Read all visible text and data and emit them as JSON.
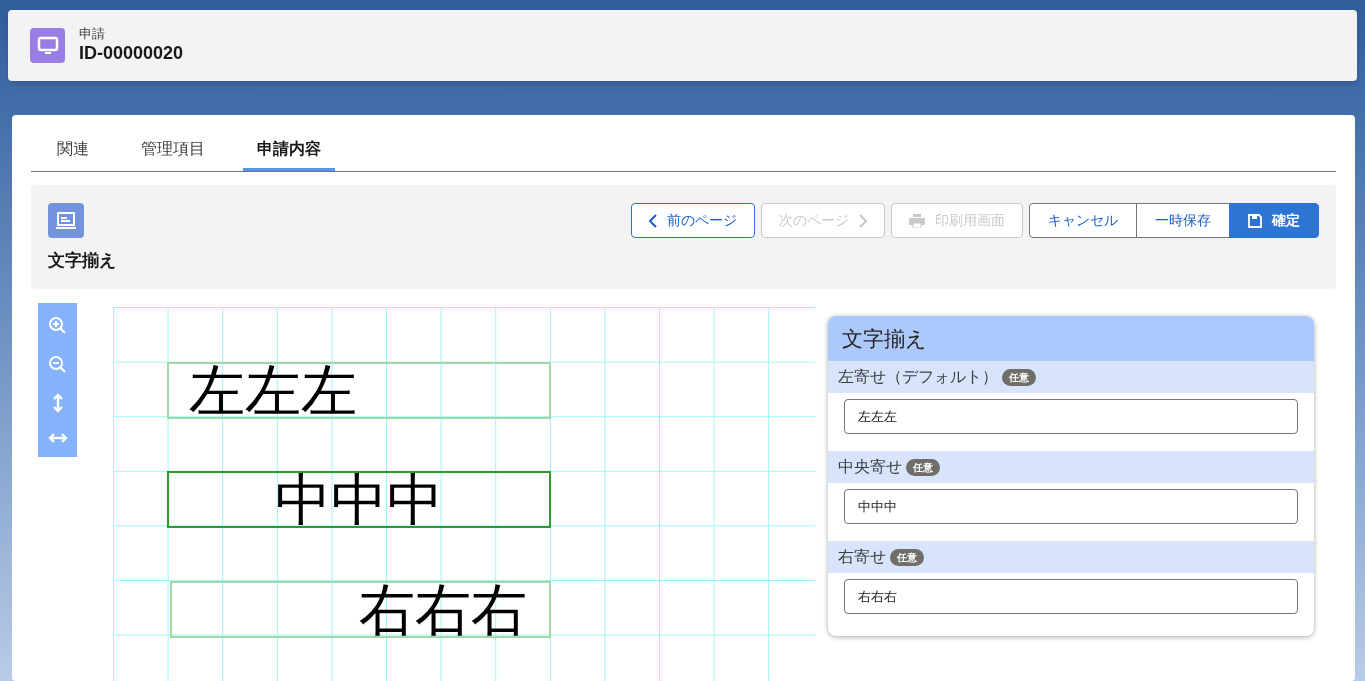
{
  "header": {
    "object_type": "申請",
    "record_id": "ID-00000020"
  },
  "tabs": [
    {
      "label": "関連",
      "selected": false
    },
    {
      "label": "管理項目",
      "selected": false
    },
    {
      "label": "申請内容",
      "selected": true
    }
  ],
  "section": {
    "title": "文字揃え"
  },
  "page_buttons": [
    {
      "label": "前のページ",
      "kind": "prev",
      "disabled": false
    },
    {
      "label": "次のページ",
      "kind": "next",
      "disabled": true
    },
    {
      "label": "印刷用画面",
      "kind": "print",
      "disabled": true
    }
  ],
  "action_buttons": [
    {
      "label": "キャンセル",
      "kind": "plain",
      "primary": false
    },
    {
      "label": "一時保存",
      "kind": "plain",
      "primary": false
    },
    {
      "label": "確定",
      "kind": "save",
      "primary": true
    }
  ],
  "canvas": {
    "text_boxes": [
      {
        "text": "左左左",
        "kind": "left",
        "selected": false
      },
      {
        "text": "中中中",
        "kind": "center",
        "selected": true
      },
      {
        "text": "右右右",
        "kind": "right",
        "selected": false
      }
    ]
  },
  "form": {
    "title": "文字揃え",
    "fields": [
      {
        "label": "左寄せ（デフォルト）",
        "badge": "任意",
        "value": "左左左"
      },
      {
        "label": "中央寄せ",
        "badge": "任意",
        "value": "中中中"
      },
      {
        "label": "右寄せ",
        "badge": "任意",
        "value": "右右右"
      }
    ]
  }
}
